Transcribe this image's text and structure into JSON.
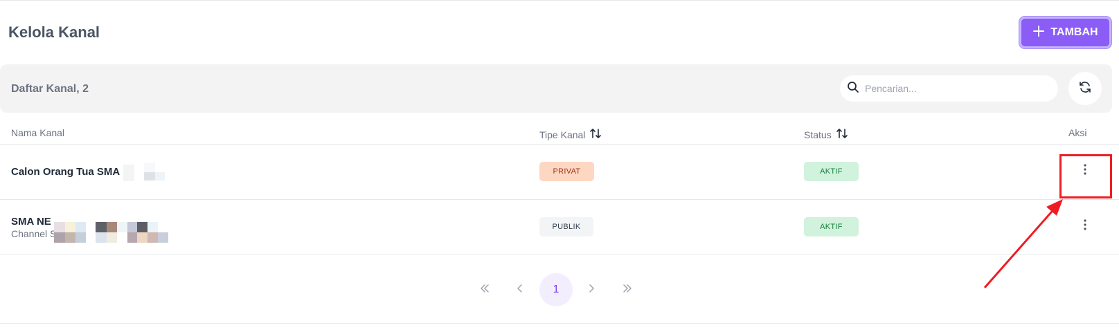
{
  "header": {
    "title": "Kelola Kanal",
    "add_button_label": "TAMBAH",
    "add_icon": "plus-icon"
  },
  "toolbar": {
    "list_title": "Daftar Kanal, 2",
    "search_placeholder": "Pencarian...",
    "search_value": "",
    "search_icon": "search-icon",
    "refresh_icon": "refresh-icon"
  },
  "table": {
    "columns": [
      {
        "label": "Nama Kanal",
        "sortable": false
      },
      {
        "label": "Tipe Kanal",
        "sortable": true
      },
      {
        "label": "Status",
        "sortable": true
      },
      {
        "label": "Aksi",
        "sortable": false
      }
    ],
    "rows": [
      {
        "name": "Calon Orang Tua SMA",
        "subtitle": "",
        "type": "PRIVAT",
        "status": "AKTIF"
      },
      {
        "name": "SMA NE",
        "subtitle": "Channel S",
        "type": "PUBLIK",
        "status": "AKTIF"
      }
    ]
  },
  "pagination": {
    "first": "«",
    "prev": "‹",
    "current": "1",
    "next": "›",
    "last": "»"
  },
  "colors": {
    "accent": "#8b5cf6",
    "privat_bg": "#fed7c3",
    "aktif_bg": "#d1f2dc",
    "annotation_red": "#ee1c24"
  }
}
